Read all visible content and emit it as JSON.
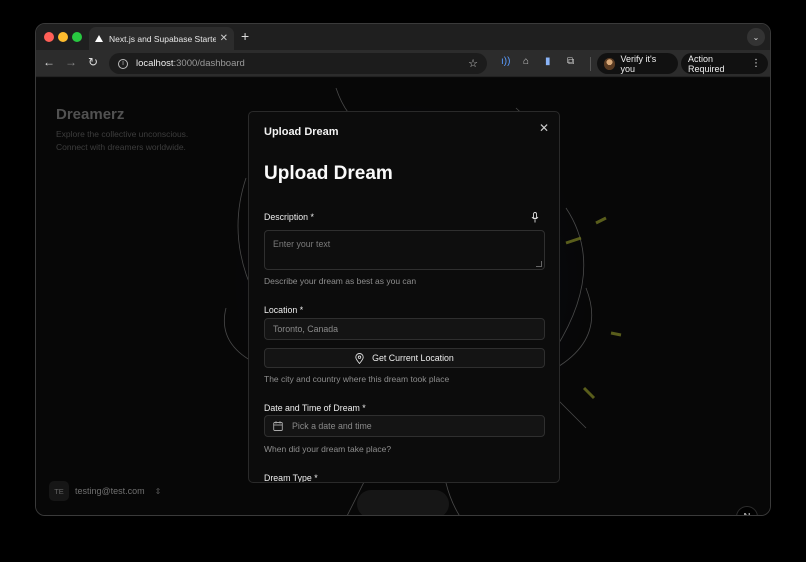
{
  "browser": {
    "tab_title": "Next.js and Supabase Starter",
    "tab_close": "✕",
    "new_tab": "+",
    "tab_menu": "⌄",
    "url_host": "localhost",
    "url_path": ":3000/dashboard",
    "verify_label": "Verify it's you",
    "action_label": "Action Required"
  },
  "page": {
    "brand": "Dreamerz",
    "tagline_1": "Explore the collective unconscious.",
    "tagline_2": "Connect with dreamers worldwide.",
    "user_initials": "TE",
    "user_email": "testing@test.com",
    "next_badge": "N"
  },
  "dialog": {
    "header": "Upload Dream",
    "close": "✕",
    "form_title": "Upload Dream",
    "description": {
      "label": "Description *",
      "placeholder": "Enter your text",
      "hint": "Describe your dream as best as you can"
    },
    "location": {
      "label": "Location *",
      "value": "Toronto, Canada",
      "button": "Get Current Location",
      "hint": "The city and country where this dream took place"
    },
    "datetime": {
      "label": "Date and Time of Dream *",
      "placeholder": "Pick a date and time",
      "hint": "When did your dream take place?"
    },
    "dream_type": {
      "label": "Dream Type *"
    }
  },
  "colors": {
    "accent_blue": "#5a9cff",
    "close_red": "#ff5f57",
    "min_yellow": "#febc2e",
    "max_green": "#28c840"
  }
}
